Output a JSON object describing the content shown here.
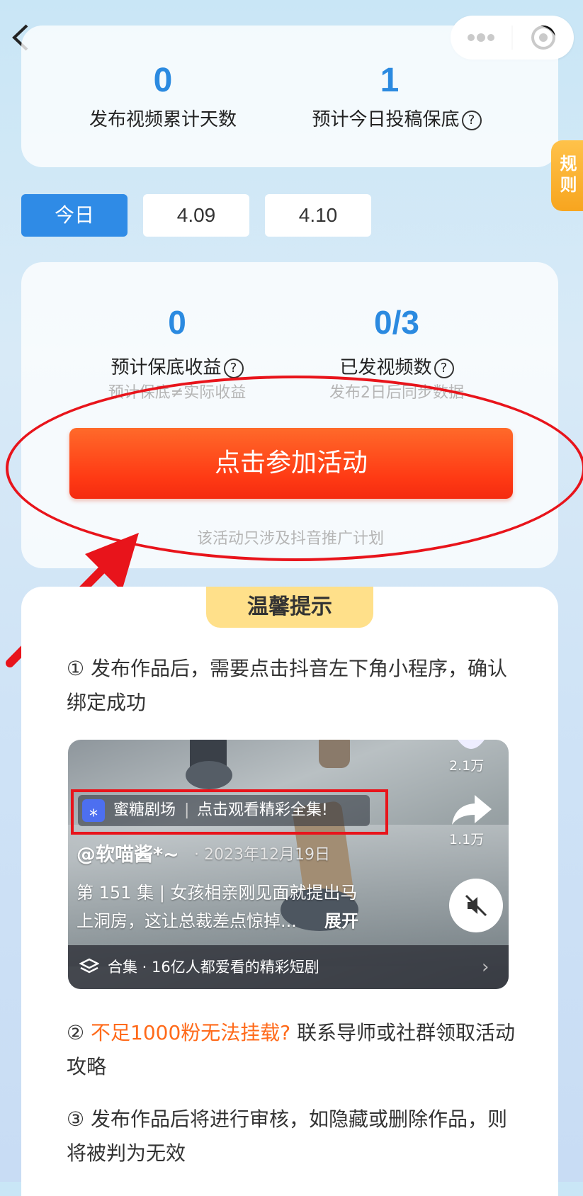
{
  "stats_top": {
    "days_value": "0",
    "days_label": "发布视频累计天数",
    "today_value": "1",
    "today_label": "预计今日投稿保底",
    "help_glyph": "?"
  },
  "rule_tab": "规则",
  "date_tabs": [
    "今日",
    "4.09",
    "4.10"
  ],
  "stats_activity": {
    "income_value": "0",
    "income_label": "预计保底收益",
    "income_note": "预计保底≠实际收益",
    "videos_value": "0/3",
    "videos_label": "已发视频数",
    "videos_note": "发布2日后同步数据"
  },
  "join_button": "点击参加活动",
  "join_note": "该活动只涉及抖音推广计划",
  "tips": {
    "title": "温馨提示",
    "tip1": "① 发布作品后，需要点击抖音左下角小程序，确认绑定成功",
    "tip2_prefix": "② ",
    "tip2_highlight": "不足1000粉无法挂载?",
    "tip2_rest": " 联系导师或社群领取活动攻略",
    "tip3": "③ 发布作品后将进行审核，如隐藏或删除作品，则将被判为无效"
  },
  "video": {
    "like_count": "2.1万",
    "share_count": "1.1万",
    "mini_program_name": "蜜糖剧场",
    "mini_program_cta": "点击观看精彩全集!",
    "author": "@软喵酱*~",
    "date": "· 2023年12月19日",
    "caption_line1": "第 151 集 | 女孩相亲刚见面就提出马",
    "caption_line2": "上洞房，这让总裁差点惊掉...",
    "expand": "展开",
    "collection": "合集 · 16亿人都爱看的精彩短剧"
  },
  "colors": {
    "accent_blue": "#2b8ae0",
    "button_orange": "#ff4a1a",
    "annotation_red": "#e8141b",
    "tip_highlight": "#ff6a1a"
  }
}
